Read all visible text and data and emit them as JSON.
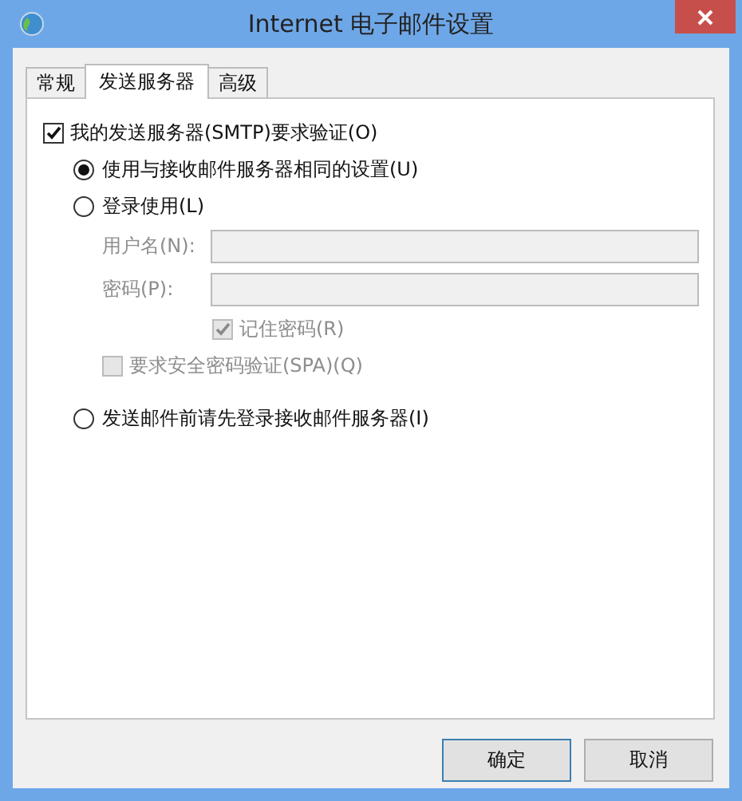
{
  "window": {
    "title": "Internet 电子邮件设置"
  },
  "tabs": [
    {
      "label": "常规",
      "selected": false
    },
    {
      "label": "发送服务器",
      "selected": true
    },
    {
      "label": "高级",
      "selected": false
    }
  ],
  "smtp_auth": {
    "label": "我的发送服务器(SMTP)要求验证(O)",
    "checked": true
  },
  "auth_modes": [
    {
      "label": "使用与接收邮件服务器相同的设置(U)",
      "selected": true
    },
    {
      "label": "登录使用(L)",
      "selected": false
    }
  ],
  "login": {
    "disabled": true,
    "fields": [
      {
        "label": "用户名(N):"
      },
      {
        "label": "密码(P):"
      }
    ],
    "remember_password": {
      "label": "记住密码(R)",
      "checked": true
    },
    "require_spa": {
      "label": "要求安全密码验证(SPA)(Q)",
      "checked": false
    }
  },
  "pre_login": {
    "label": "发送邮件前请先登录接收邮件服务器(I)",
    "selected": false
  },
  "buttons": [
    "确定",
    "取消"
  ]
}
